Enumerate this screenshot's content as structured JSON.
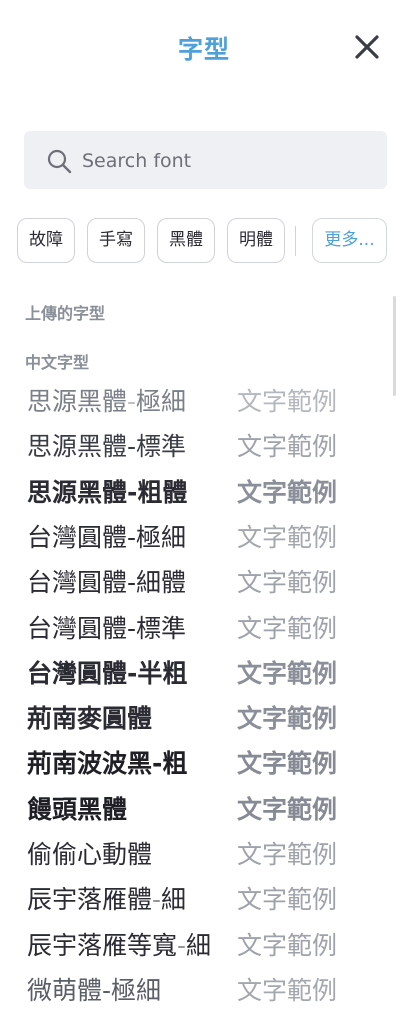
{
  "header": {
    "title": "字型"
  },
  "search": {
    "placeholder": "Search font"
  },
  "chips": [
    "故障",
    "手寫",
    "黑體",
    "明體"
  ],
  "more_chip": "更多...",
  "sections": {
    "uploaded": "上傳的字型",
    "chinese": "中文字型"
  },
  "font_list": [
    {
      "name": "思源黑體-極細",
      "sample": "文字範例",
      "weight": "200",
      "name_color": "#7a7f88",
      "sample_color": "#b3b7be"
    },
    {
      "name": "思源黑體-標準",
      "sample": "文字範例",
      "weight": "normal",
      "name_color": "#3a3d45",
      "sample_color": "#9ea2aa"
    },
    {
      "name": "思源黑體-粗體",
      "sample": "文字範例",
      "weight": "bold",
      "name_color": "#2b2b33",
      "sample_color": "#8a8f99"
    },
    {
      "name": "台灣圓體-極細",
      "sample": "文字範例",
      "weight": "normal",
      "name_color": "#2b2b33",
      "sample_color": "#a3a7ae"
    },
    {
      "name": "台灣圓體-細體",
      "sample": "文字範例",
      "weight": "normal",
      "name_color": "#2b2b33",
      "sample_color": "#9ea2aa"
    },
    {
      "name": "台灣圓體-標準",
      "sample": "文字範例",
      "weight": "normal",
      "name_color": "#2b2b33",
      "sample_color": "#9ea2aa"
    },
    {
      "name": "台灣圓體-半粗",
      "sample": "文字範例",
      "weight": "bold",
      "name_color": "#2b2b33",
      "sample_color": "#8a8f99"
    },
    {
      "name": "荊南麥圓體",
      "sample": "文字範例",
      "weight": "bold",
      "name_color": "#2b2b33",
      "sample_color": "#8a8f99"
    },
    {
      "name": "荊南波波黑-粗",
      "sample": "文字範例",
      "weight": "900",
      "name_color": "#1f1f26",
      "sample_color": "#858a94"
    },
    {
      "name": "饅頭黑體",
      "sample": "文字範例",
      "weight": "900",
      "name_color": "#1f1f26",
      "sample_color": "#858a94"
    },
    {
      "name": "偷偷心動體",
      "sample": "文字範例",
      "weight": "normal",
      "name_color": "#2b2b33",
      "sample_color": "#9ea2aa"
    },
    {
      "name": "辰宇落雁體-細",
      "sample": "文字範例",
      "weight": "200",
      "name_color": "#2b2b33",
      "sample_color": "#9ea2aa"
    },
    {
      "name": "辰宇落雁等寬-細",
      "sample": "文字範例",
      "weight": "200",
      "name_color": "#2b2b33",
      "sample_color": "#9ea2aa"
    },
    {
      "name": "微萌體-極細",
      "sample": "文字範例",
      "weight": "normal",
      "name_color": "#5a5e66",
      "sample_color": "#a3a7ae"
    }
  ]
}
